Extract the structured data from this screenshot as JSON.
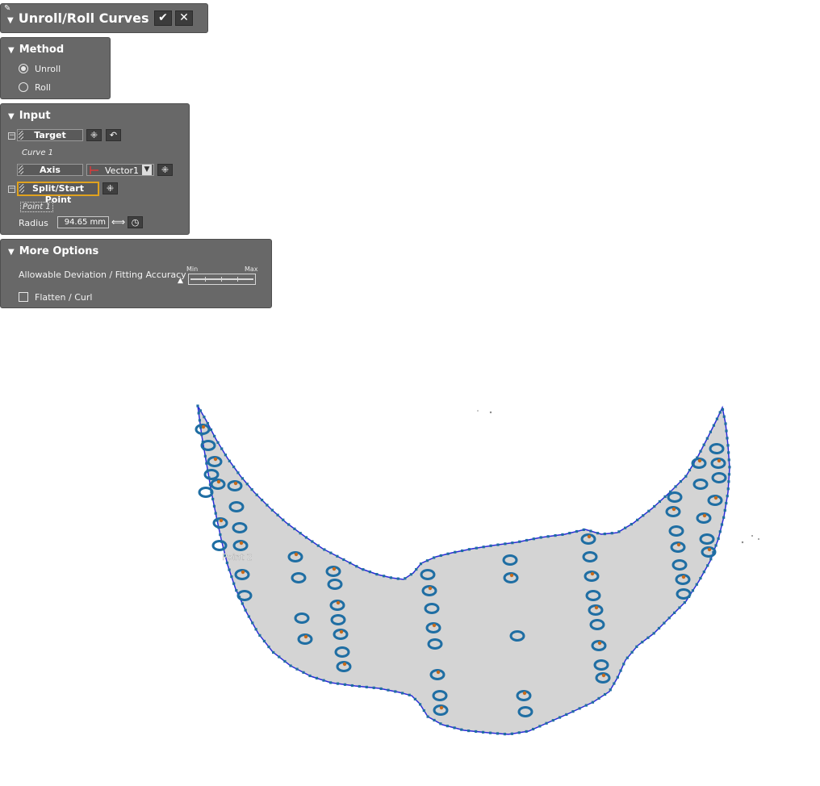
{
  "titlebar": {
    "title": "Unroll/Roll Curves",
    "ok_icon": "checkmark-icon",
    "cancel_icon": "close-icon"
  },
  "method": {
    "header": "Method",
    "options": [
      {
        "label": "Unroll",
        "selected": true
      },
      {
        "label": "Roll",
        "selected": false
      }
    ]
  },
  "input": {
    "header": "Input",
    "target_label": "Target",
    "target_value": "Curve 1",
    "axis_label": "Axis",
    "axis_value": "Vector1",
    "split_label": "Split/Start Point",
    "split_value": "Point 1",
    "radius_label": "Radius",
    "radius_value": "94.65 mm"
  },
  "more_options": {
    "header": "More Options",
    "deviation_label": "Allowable Deviation / Fitting Accuracy",
    "slider_min": "Min",
    "slider_max": "Max",
    "flatten_label": "Flatten / Curl",
    "flatten_checked": false
  },
  "viewport": {
    "point_label": "Point 2",
    "colors": {
      "fill": "#d4d4d4",
      "outline": "#2b2bd9",
      "hole": "#1f6ea3",
      "dot": "#c86a1a"
    }
  }
}
